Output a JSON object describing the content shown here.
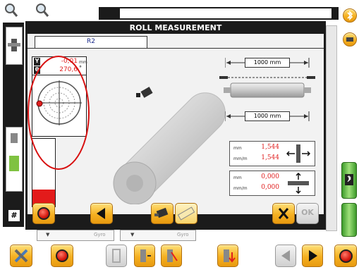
{
  "dialog": {
    "title": "ROLL MEASUREMENT",
    "tab_label": "R2",
    "readout": {
      "y_label": "Y",
      "y_value": "-0,01",
      "y_unit": "mm",
      "theta_label": "θ",
      "theta_value": "270,6",
      "theta_unit": "°"
    },
    "top_dimension": "1000 mm",
    "bottom_dimension": "1000 mm",
    "result1": {
      "unit1": "mm",
      "value1": "1,544",
      "unit2": "mm/m",
      "value2": "1,544"
    },
    "result2": {
      "unit1": "mm",
      "value1": "0,000",
      "unit2": "mm/m",
      "value2": "0,000"
    },
    "ok_label": "OK",
    "level_fill": 0.32
  },
  "background": {
    "hash_label": "#",
    "dropdown1_label": "Gyro",
    "dropdown2_label": "Gyro"
  },
  "colors": {
    "accent_orange": "#f5b021",
    "highlight_red": "#e02020",
    "dialog_border": "#1b1b1b"
  }
}
